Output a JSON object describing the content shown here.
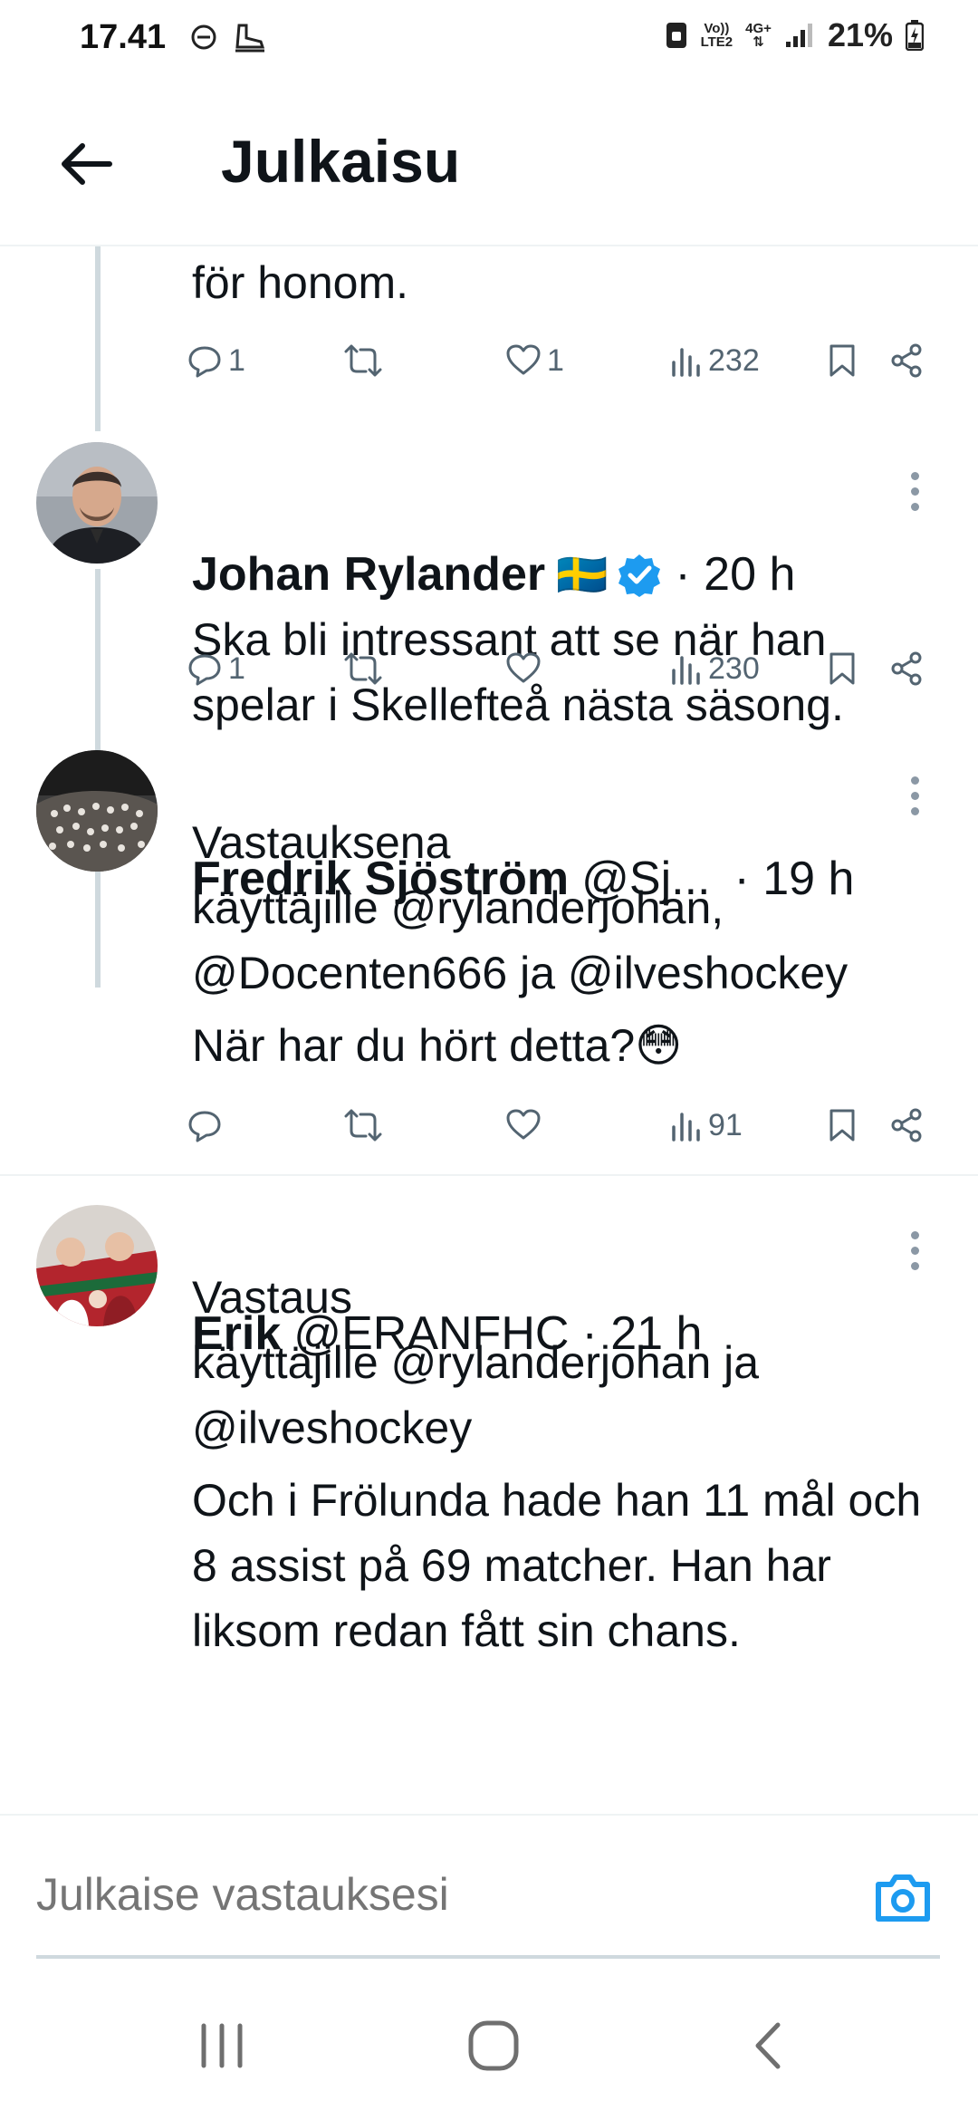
{
  "status_bar": {
    "time": "17.41",
    "network_top": "Vo))",
    "network_bottom": "LTE2",
    "data_type": "4G+",
    "battery_percent": "21%"
  },
  "header": {
    "title": "Julkaisu"
  },
  "posts": [
    {
      "text_tail": "för honom.",
      "replies": "1",
      "reposts": "",
      "likes": "1",
      "views": "232"
    },
    {
      "name": "Johan Rylander",
      "flag": "🇸🇪",
      "verified": true,
      "time": "· 20 h",
      "text": "Ska bli intressant att se när han spelar i Skellefteå nästa säsong.",
      "replies": "1",
      "reposts": "",
      "likes": "",
      "views": "230"
    },
    {
      "name": "Fredrik Sjöström",
      "handle": "@Sj...",
      "time": "· 19 h",
      "reply_intro": "Vastauksena",
      "reply_to": "käyttäjille @rylanderjohan,",
      "reply_to_2": "@Docenten666 ja @ilveshockey",
      "text": "När har du hört detta?😳",
      "replies": "",
      "reposts": "",
      "likes": "",
      "views": "91"
    },
    {
      "name": "Erik",
      "handle": "@ERANFHC",
      "time": "· 21 h",
      "reply_intro": "Vastaus",
      "reply_to": "käyttäjille @rylanderjohan ja",
      "reply_to_2": "@ilveshockey",
      "text": "Och i Frölunda hade han 11 mål och 8 assist på 69 matcher. Han har liksom redan fått sin chans."
    }
  ],
  "reply_bar": {
    "placeholder": "Julkaise vastauksesi"
  },
  "colors": {
    "accent": "#1d9bf0",
    "icon_gray": "#536471",
    "thread_line": "#cfd9de"
  }
}
